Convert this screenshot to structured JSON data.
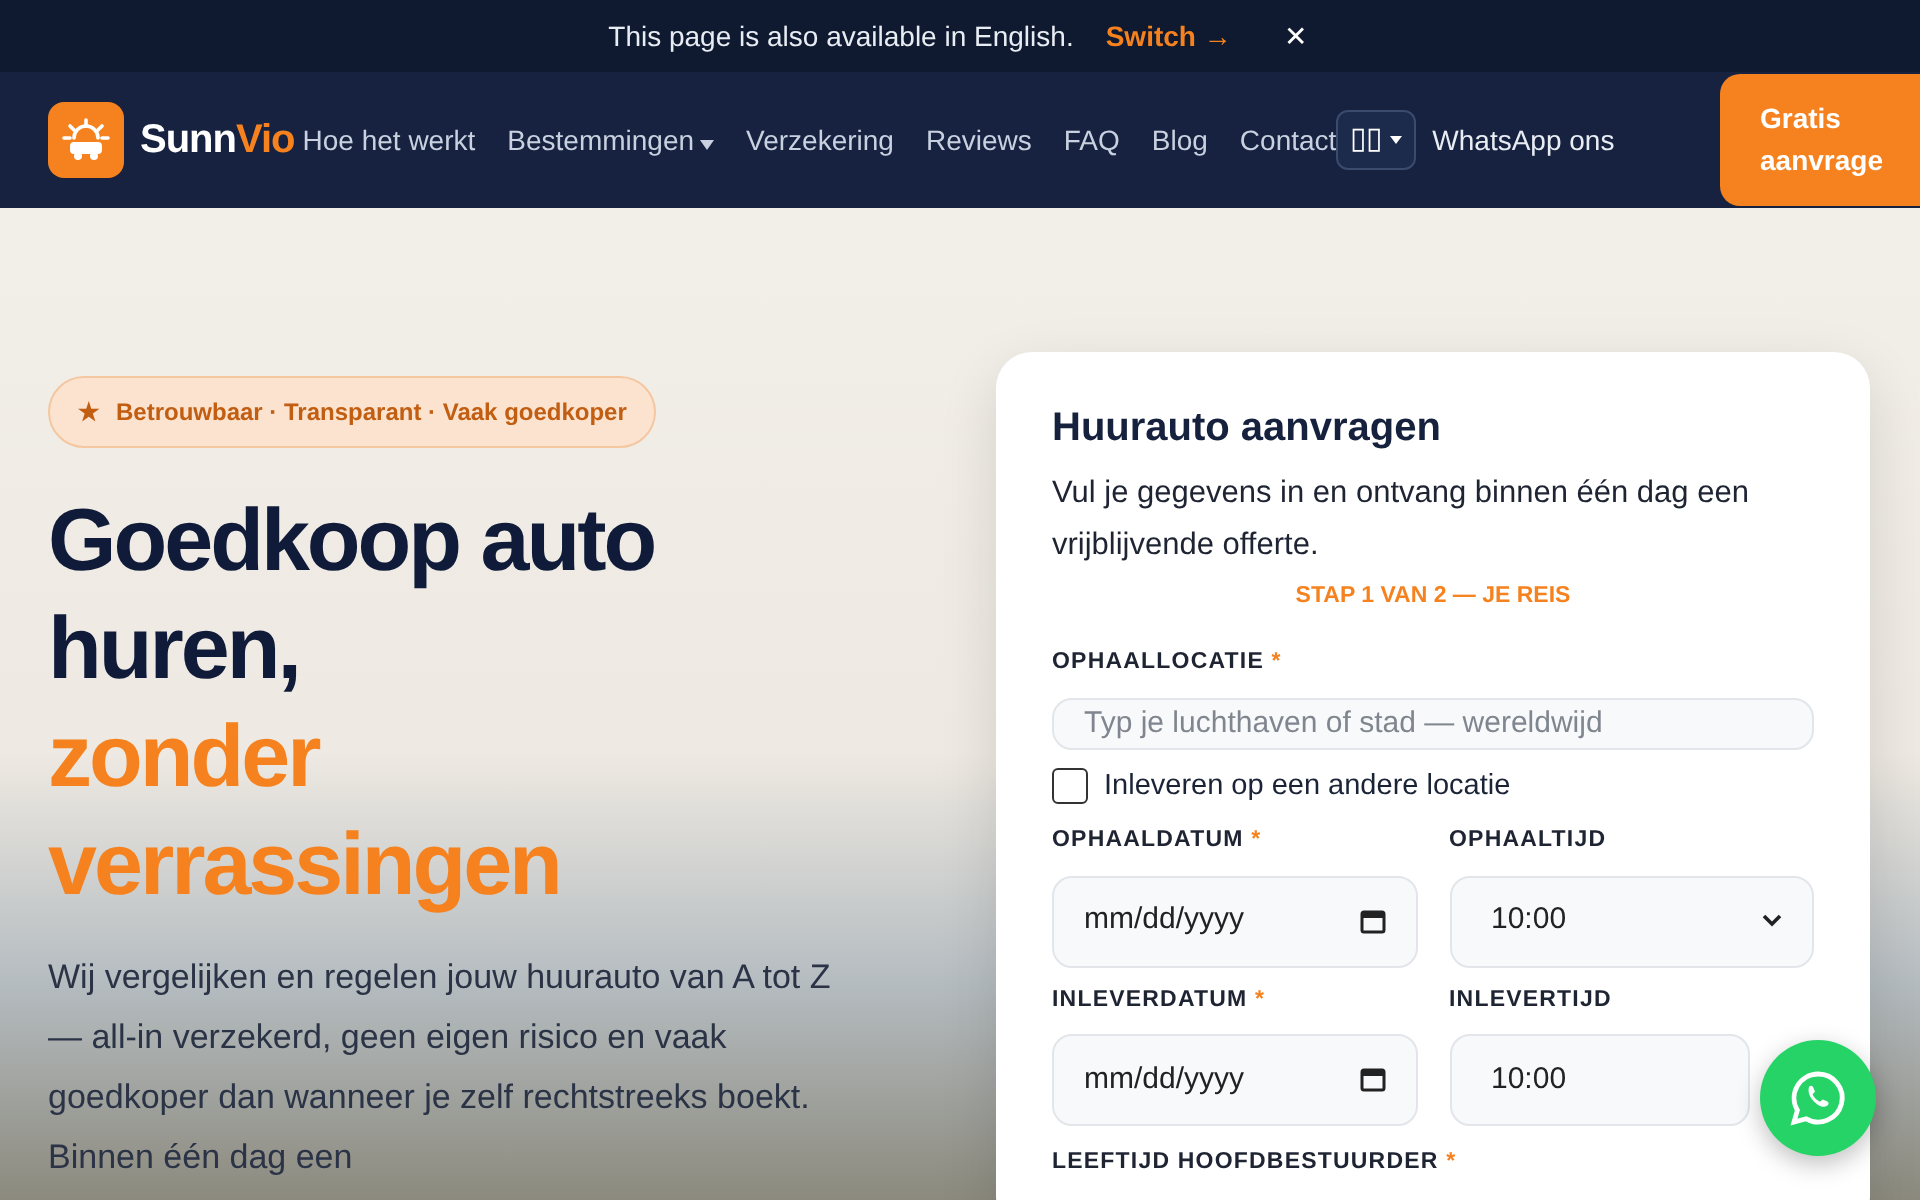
{
  "language_banner": {
    "message": "This page is also available in English.",
    "link": "Switch →",
    "close": "✕"
  },
  "navbar": {
    "brand": {
      "part1": "Sunn",
      "part2": "Vio"
    },
    "links": [
      {
        "label": "Hoe het werkt",
        "dropdown": false
      },
      {
        "label": "Bestemmingen",
        "dropdown": true
      },
      {
        "label": "Verzekering",
        "dropdown": false
      },
      {
        "label": "Reviews",
        "dropdown": false
      },
      {
        "label": "FAQ",
        "dropdown": false
      },
      {
        "label": "Blog",
        "dropdown": false
      },
      {
        "label": "Contact",
        "dropdown": false
      }
    ],
    "language_button": {
      "flag": "▯▯"
    },
    "whatsapp_link": "WhatsApp ons",
    "cta_button": "Gratis aanvrage"
  },
  "hero": {
    "badge": {
      "icon": "★",
      "text": "Betrouwbaar · Transparant · Vaak goedkoper"
    },
    "headline_lines": [
      {
        "text": "Goedkoop auto",
        "accent": false
      },
      {
        "text": "huren,",
        "accent": false
      },
      {
        "text": "zonder",
        "accent": true
      },
      {
        "text": "verrassingen",
        "accent": true
      }
    ],
    "intro": "Wij vergelijken en regelen jouw huurauto van A tot Z — all-in verzekerd, geen eigen risico en vaak goedkoper dan wanneer je zelf rechtstreeks boekt. Binnen één dag een"
  },
  "form": {
    "title": "Huurauto aanvragen",
    "subtitle": "Vul je gegevens in en ontvang binnen één dag een vrijblijvende offerte.",
    "step": "STAP 1 VAN 2 — JE REIS",
    "pickup_location": {
      "label": "OPHAALLOCATIE",
      "marker": "*",
      "placeholder": "Typ je luchthaven of stad — wereldwijd"
    },
    "other_dropoff": {
      "label": "Inleveren op een andere locatie",
      "checked": false
    },
    "rows": [
      [
        {
          "kind": "date",
          "label": "OPHAALDATUM",
          "marker": "*",
          "value": "mm/dd/yyyy"
        },
        {
          "kind": "select",
          "label": "OPHAALTIJD",
          "value": "10:00"
        }
      ],
      [
        {
          "kind": "date",
          "label": "INLEVERDATUM",
          "marker": "*",
          "value": "mm/dd/yyyy"
        },
        {
          "kind": "select",
          "label": "INLEVERTIJD",
          "value": "10:00"
        }
      ]
    ],
    "age_label": {
      "label": "LEEFTIJD HOOFDBESTUURDER",
      "marker": "*"
    }
  }
}
